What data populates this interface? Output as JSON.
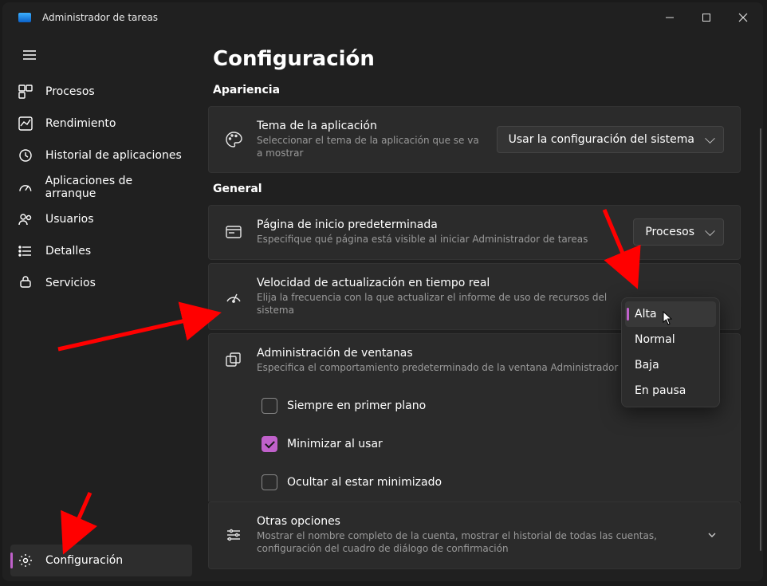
{
  "titlebar": {
    "title": "Administrador de tareas"
  },
  "sidebar": {
    "items": [
      {
        "label": "Procesos"
      },
      {
        "label": "Rendimiento"
      },
      {
        "label": "Historial de aplicaciones"
      },
      {
        "label": "Aplicaciones de arranque"
      },
      {
        "label": "Usuarios"
      },
      {
        "label": "Detalles"
      },
      {
        "label": "Servicios"
      }
    ],
    "settings_label": "Configuración"
  },
  "page": {
    "title": "Configuración",
    "section_appearance": "Apariencia",
    "section_general": "General"
  },
  "appearance": {
    "theme": {
      "title": "Tema de la aplicación",
      "desc": "Seleccionar el tema de la aplicación que se va a mostrar",
      "value": "Usar la configuración del sistema"
    }
  },
  "general": {
    "default_page": {
      "title": "Página de inicio predeterminada",
      "desc": "Especifique qué página está visible al iniciar Administrador de tareas",
      "value": "Procesos"
    },
    "refresh": {
      "title": "Velocidad de actualización en tiempo real",
      "desc": "Elija la frecuencia con la que actualizar el informe de uso de recursos del sistema",
      "options": [
        "Alta",
        "Normal",
        "Baja",
        "En pausa"
      ],
      "selected": "Alta"
    },
    "windows": {
      "title": "Administración de ventanas",
      "desc": "Especifica el comportamiento predeterminado de la ventana Administrador de tar",
      "always_on_top": "Siempre en primer plano",
      "minimize_on_use": "Minimizar al usar",
      "hide_when_min": "Ocultar al estar minimizado"
    },
    "other": {
      "title": "Otras opciones",
      "desc": "Mostrar el nombre completo de la cuenta, mostrar el historial de todas las cuentas, configuración del cuadro de diálogo de confirmación"
    }
  }
}
